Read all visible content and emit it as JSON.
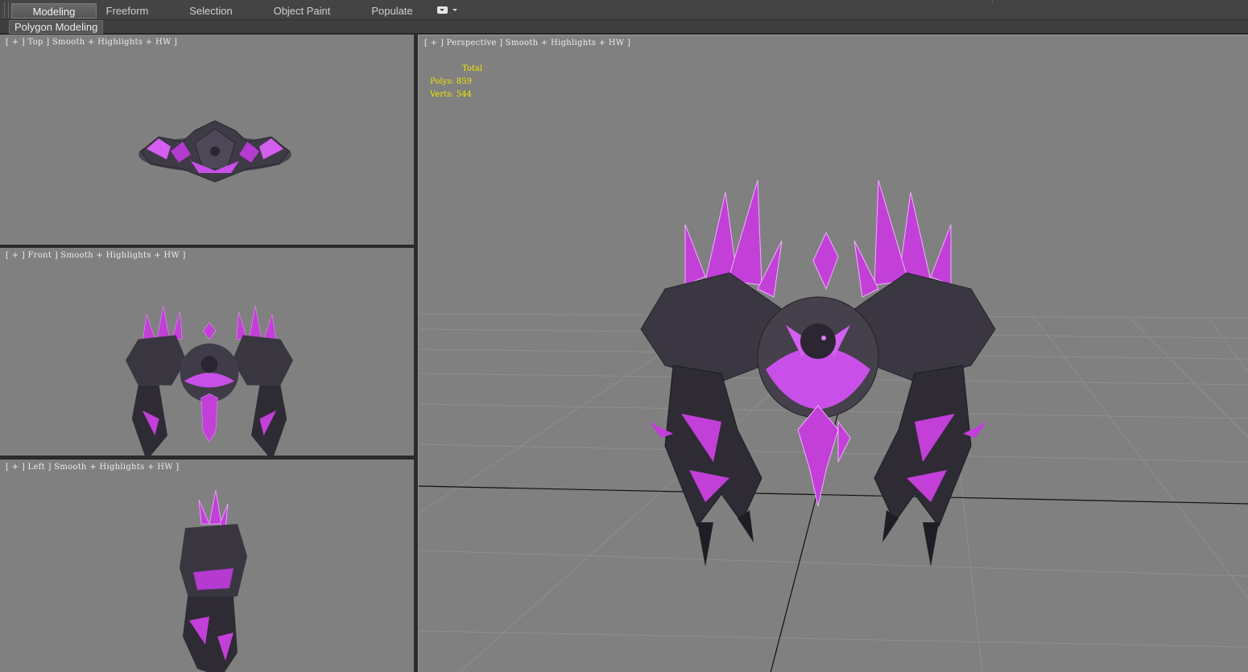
{
  "ribbon": {
    "tabs": [
      {
        "label": "Modeling",
        "active": true
      },
      {
        "label": "Freeform",
        "active": false
      },
      {
        "label": "Selection",
        "active": false
      },
      {
        "label": "Object Paint",
        "active": false
      },
      {
        "label": "Populate",
        "active": false
      }
    ],
    "panel_label": "Polygon Modeling"
  },
  "viewports": {
    "top": {
      "label": "[ + ] Top ] Smooth + Highlights + HW ]"
    },
    "front": {
      "label": "[ + ] Front ] Smooth + Highlights + HW ]"
    },
    "left": {
      "label": "[ + ] Left ] Smooth + Highlights + HW ]"
    },
    "perspective": {
      "label": "[ + ] Perspective ] Smooth + Highlights + HW ]"
    }
  },
  "stats": {
    "header": "Total",
    "polys_label": "Polys:",
    "polys_value": "859",
    "verts_label": "Verts:",
    "verts_value": "544"
  },
  "colors": {
    "viewport_bg": "#808080",
    "stats_text": "#f2e600",
    "crystal": "#c23fd8",
    "rock": "#3a3640"
  }
}
